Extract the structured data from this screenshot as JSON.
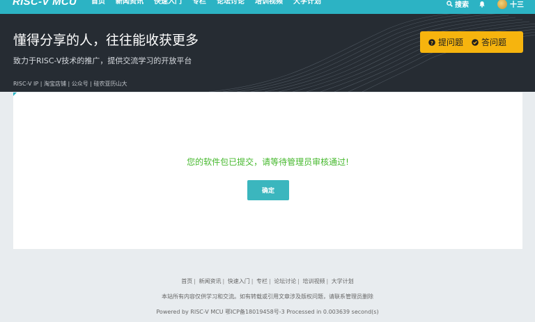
{
  "nav": {
    "logo": "RISC-V MCU",
    "links": [
      "首页",
      "新闻资讯",
      "快速入门",
      "专栏",
      "论坛讨论",
      "培训视频",
      "大学计划"
    ],
    "search_label": "搜索",
    "user_name": "十三",
    "bar_color": "#2cb3c4"
  },
  "hero": {
    "title": "懂得分享的人，往往能收获更多",
    "subtitle": "致力于RISC-V技术的推广，提供交流学习的开放平台",
    "links": [
      "RISC-V IP",
      "淘宝店铺",
      "公众号",
      "硅农亚历山大"
    ],
    "ask_label": "提问题",
    "answer_label": "答问题",
    "button_color": "#f6b40e"
  },
  "main": {
    "message": "您的软件包已提交，请等待管理员审核通过!",
    "confirm_label": "确定",
    "message_color": "#45b82c"
  },
  "footer": {
    "links": [
      "首页",
      "新闻资讯",
      "快速入门",
      "专栏",
      "论坛讨论",
      "培训视频",
      "大学计划"
    ],
    "notice": "本站所有内容仅供学习和交流。如有转载或引用文章涉及版权问题，请联系管理员删除",
    "powered": "Powered by RISC-V MCU 鄂ICP备18019458号-3 Processed in 0.003639 second(s)"
  }
}
